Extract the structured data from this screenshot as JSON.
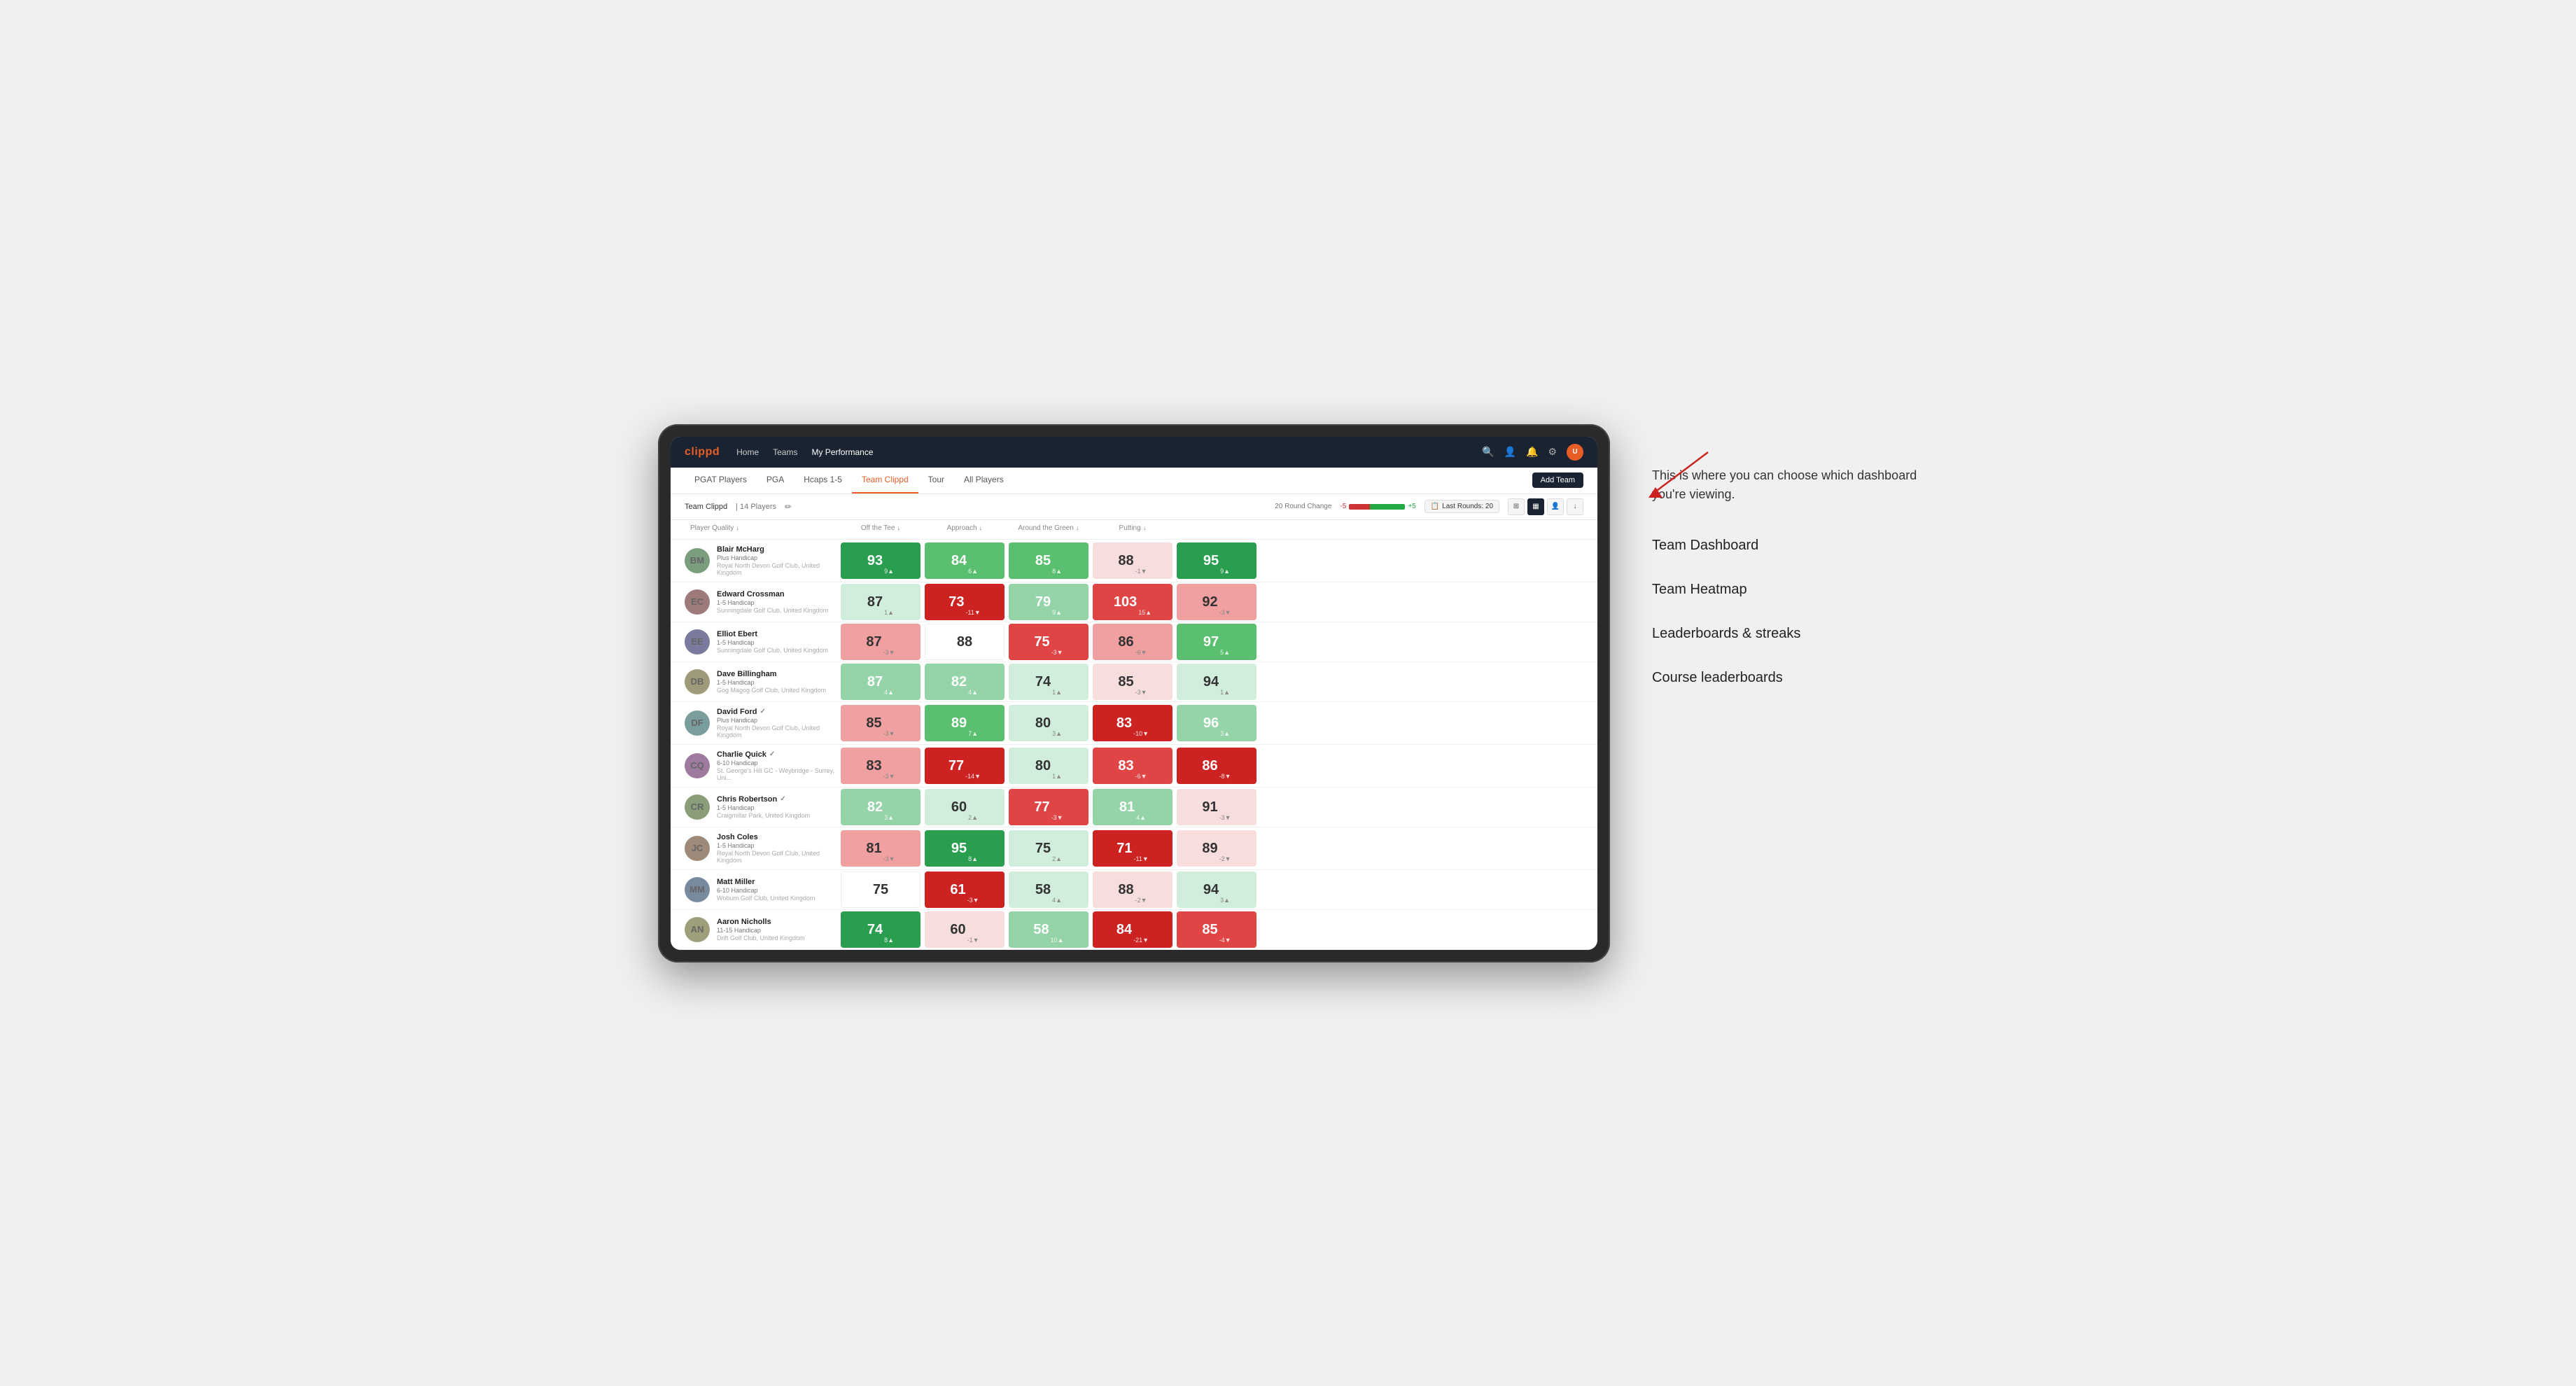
{
  "annotation": {
    "intro_text": "This is where you can choose which dashboard you're viewing.",
    "menu_items": [
      "Team Dashboard",
      "Team Heatmap",
      "Leaderboards & streaks",
      "Course leaderboards"
    ]
  },
  "nav": {
    "logo": "clippd",
    "links": [
      "Home",
      "Teams",
      "My Performance"
    ],
    "active_link": "My Performance"
  },
  "sub_nav": {
    "links": [
      "PGAT Players",
      "PGA",
      "Hcaps 1-5",
      "Team Clippd",
      "Tour",
      "All Players"
    ],
    "active": "Team Clippd",
    "add_team": "Add Team"
  },
  "team_bar": {
    "team_name": "Team Clippd",
    "separator": "|",
    "player_count": "14 Players",
    "round_change_label": "20 Round Change",
    "change_neg": "-5",
    "change_pos": "+5",
    "last_rounds_label": "Last Rounds:",
    "last_rounds_value": "20"
  },
  "table": {
    "columns": [
      "Player Quality ↓",
      "Off the Tee ↓",
      "Approach ↓",
      "Around the Green ↓",
      "Putting ↓"
    ],
    "players": [
      {
        "name": "Blair McHarg",
        "handicap": "Plus Handicap",
        "club": "Royal North Devon Golf Club, United Kingdom",
        "initials": "BM",
        "scores": [
          {
            "value": "93",
            "change": "9▲",
            "color": "green-dark"
          },
          {
            "value": "84",
            "change": "6▲",
            "color": "green-mid"
          },
          {
            "value": "85",
            "change": "8▲",
            "color": "green-mid"
          },
          {
            "value": "88",
            "change": "-1▼",
            "color": "very-light-red"
          },
          {
            "value": "95",
            "change": "9▲",
            "color": "green-dark"
          }
        ]
      },
      {
        "name": "Edward Crossman",
        "handicap": "1-5 Handicap",
        "club": "Sunningdale Golf Club, United Kingdom",
        "initials": "EC",
        "scores": [
          {
            "value": "87",
            "change": "1▲",
            "color": "very-light-green"
          },
          {
            "value": "73",
            "change": "-11▼",
            "color": "red-dark"
          },
          {
            "value": "79",
            "change": "9▲",
            "color": "green-light"
          },
          {
            "value": "103",
            "change": "15▲",
            "color": "red-mid"
          },
          {
            "value": "92",
            "change": "-3▼",
            "color": "red-light"
          }
        ]
      },
      {
        "name": "Elliot Ebert",
        "handicap": "1-5 Handicap",
        "club": "Sunningdale Golf Club, United Kingdom",
        "initials": "EE",
        "scores": [
          {
            "value": "87",
            "change": "-3▼",
            "color": "red-light"
          },
          {
            "value": "88",
            "change": "",
            "color": "white"
          },
          {
            "value": "75",
            "change": "-3▼",
            "color": "red-mid"
          },
          {
            "value": "86",
            "change": "-6▼",
            "color": "red-light"
          },
          {
            "value": "97",
            "change": "5▲",
            "color": "green-mid"
          }
        ]
      },
      {
        "name": "Dave Billingham",
        "handicap": "1-5 Handicap",
        "club": "Gog Magog Golf Club, United Kingdom",
        "initials": "DB",
        "scores": [
          {
            "value": "87",
            "change": "4▲",
            "color": "green-light"
          },
          {
            "value": "82",
            "change": "4▲",
            "color": "green-light"
          },
          {
            "value": "74",
            "change": "1▲",
            "color": "very-light-green"
          },
          {
            "value": "85",
            "change": "-3▼",
            "color": "very-light-red"
          },
          {
            "value": "94",
            "change": "1▲",
            "color": "very-light-green"
          }
        ]
      },
      {
        "name": "David Ford",
        "handicap": "Plus Handicap",
        "club": "Royal North Devon Golf Club, United Kingdom",
        "initials": "DF",
        "has_icon": true,
        "scores": [
          {
            "value": "85",
            "change": "-3▼",
            "color": "red-light"
          },
          {
            "value": "89",
            "change": "7▲",
            "color": "green-mid"
          },
          {
            "value": "80",
            "change": "3▲",
            "color": "very-light-green"
          },
          {
            "value": "83",
            "change": "-10▼",
            "color": "red-dark"
          },
          {
            "value": "96",
            "change": "3▲",
            "color": "green-light"
          }
        ]
      },
      {
        "name": "Charlie Quick",
        "handicap": "6-10 Handicap",
        "club": "St. George's Hill GC - Weybridge - Surrey, Uni...",
        "initials": "CQ",
        "has_icon": true,
        "scores": [
          {
            "value": "83",
            "change": "-3▼",
            "color": "red-light"
          },
          {
            "value": "77",
            "change": "-14▼",
            "color": "red-dark"
          },
          {
            "value": "80",
            "change": "1▲",
            "color": "very-light-green"
          },
          {
            "value": "83",
            "change": "-6▼",
            "color": "red-mid"
          },
          {
            "value": "86",
            "change": "-8▼",
            "color": "red-dark"
          }
        ]
      },
      {
        "name": "Chris Robertson",
        "handicap": "1-5 Handicap",
        "club": "Craigmillar Park, United Kingdom",
        "initials": "CR",
        "has_icon": true,
        "scores": [
          {
            "value": "82",
            "change": "3▲",
            "color": "green-light"
          },
          {
            "value": "60",
            "change": "2▲",
            "color": "very-light-green"
          },
          {
            "value": "77",
            "change": "-3▼",
            "color": "red-mid"
          },
          {
            "value": "81",
            "change": "4▲",
            "color": "green-light"
          },
          {
            "value": "91",
            "change": "-3▼",
            "color": "very-light-red"
          }
        ]
      },
      {
        "name": "Josh Coles",
        "handicap": "1-5 Handicap",
        "club": "Royal North Devon Golf Club, United Kingdom",
        "initials": "JC",
        "scores": [
          {
            "value": "81",
            "change": "-3▼",
            "color": "red-light"
          },
          {
            "value": "95",
            "change": "8▲",
            "color": "green-dark"
          },
          {
            "value": "75",
            "change": "2▲",
            "color": "very-light-green"
          },
          {
            "value": "71",
            "change": "-11▼",
            "color": "red-dark"
          },
          {
            "value": "89",
            "change": "-2▼",
            "color": "very-light-red"
          }
        ]
      },
      {
        "name": "Matt Miller",
        "handicap": "6-10 Handicap",
        "club": "Woburn Golf Club, United Kingdom",
        "initials": "MM",
        "scores": [
          {
            "value": "75",
            "change": "",
            "color": "white"
          },
          {
            "value": "61",
            "change": "-3▼",
            "color": "red-dark"
          },
          {
            "value": "58",
            "change": "4▲",
            "color": "very-light-green"
          },
          {
            "value": "88",
            "change": "-2▼",
            "color": "very-light-red"
          },
          {
            "value": "94",
            "change": "3▲",
            "color": "very-light-green"
          }
        ]
      },
      {
        "name": "Aaron Nicholls",
        "handicap": "11-15 Handicap",
        "club": "Drift Golf Club, United Kingdom",
        "initials": "AN",
        "scores": [
          {
            "value": "74",
            "change": "8▲",
            "color": "green-dark"
          },
          {
            "value": "60",
            "change": "-1▼",
            "color": "very-light-red"
          },
          {
            "value": "58",
            "change": "10▲",
            "color": "green-light"
          },
          {
            "value": "84",
            "change": "-21▼",
            "color": "red-dark"
          },
          {
            "value": "85",
            "change": "-4▼",
            "color": "red-mid"
          }
        ]
      }
    ]
  }
}
